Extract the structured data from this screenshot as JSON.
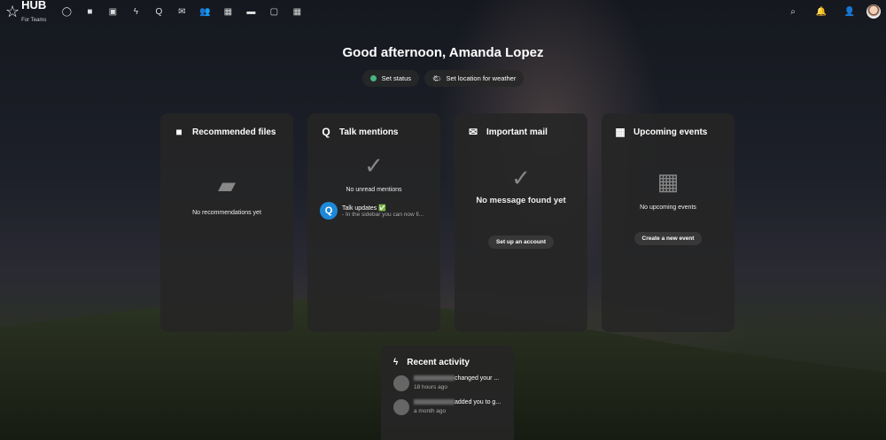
{
  "logo": {
    "name": "HUB",
    "tagline": "For Teams"
  },
  "nav": [
    "dashboard-icon",
    "files-icon",
    "photos-icon",
    "activity-icon",
    "talk-icon",
    "mail-icon",
    "contacts-icon",
    "calendar-icon",
    "deck-icon",
    "tasks-icon",
    "calendar-alt-icon"
  ],
  "greeting": "Good afternoon, Amanda Lopez",
  "status_button": "Set status",
  "weather_button": "Set location for weather",
  "cards": {
    "files": {
      "title": "Recommended files",
      "empty": "No recommendations yet"
    },
    "talk": {
      "title": "Talk mentions",
      "empty": "No unread mentions",
      "item_title": "Talk updates ✅",
      "item_text": "- In the sidebar you can now fi..."
    },
    "mail": {
      "title": "Important mail",
      "empty": "No message found yet",
      "button": "Set up an account"
    },
    "events": {
      "title": "Upcoming events",
      "empty": "No upcoming events",
      "button": "Create a new event"
    }
  },
  "activity": {
    "title": "Recent activity",
    "items": [
      {
        "action": "changed your ...",
        "time": "18 hours ago"
      },
      {
        "action": "added you to g...",
        "time": "a month ago"
      }
    ]
  }
}
